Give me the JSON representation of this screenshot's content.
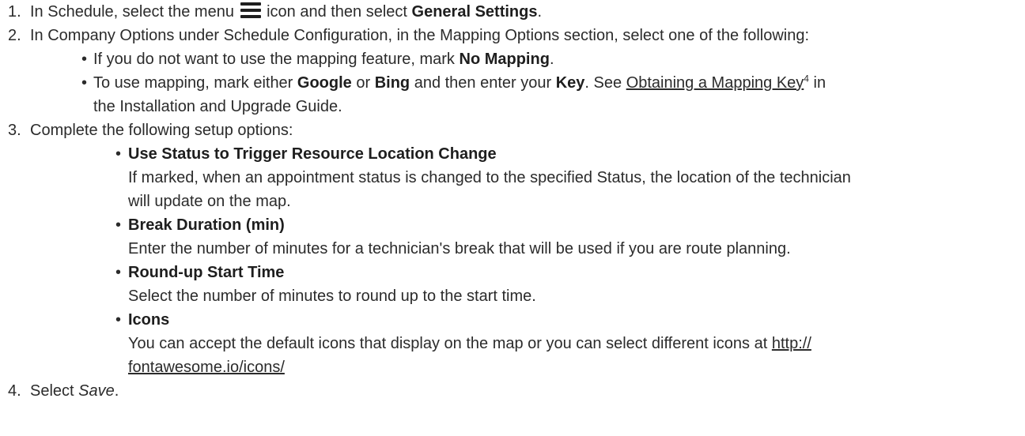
{
  "steps": [
    {
      "number": "1.",
      "t1": "In Schedule, select the menu",
      "icon": "menu-icon",
      "t2": " icon and then select ",
      "bold": "General Settings",
      "t3": "."
    },
    {
      "number": "2.",
      "text": "In Company Options under Schedule Configuration, in the Mapping Options section, select one of the following:",
      "bullets": [
        {
          "t1": "If you do not want to use the mapping feature, mark ",
          "b1": "No Mapping",
          "t2": "."
        },
        {
          "t1": "To use mapping, mark either ",
          "b1": "Google",
          "t2": " or ",
          "b2": "Bing",
          "t3": " and then enter your ",
          "b3": "Key",
          "t4": ". See ",
          "link": "Obtaining a Mapping Key",
          "sup": "4",
          "t5": " in",
          "cont": "the Installation and Upgrade Guide."
        }
      ]
    },
    {
      "number": "3.",
      "text": "Complete the following setup options:",
      "options": [
        {
          "title": "Use Status to Trigger Resource Location Change",
          "desc1": "If marked, when an appointment status is changed to the specified Status, the location of the technician",
          "desc2": "will update on the map."
        },
        {
          "title": "Break Duration (min)",
          "desc1": "Enter the number of minutes for a technician's break that will be used if you are route planning."
        },
        {
          "title": "Round-up Start Time",
          "desc1": "Select the number of minutes to round up to the start time."
        },
        {
          "title": "Icons",
          "desc1": "You can accept the default icons that display on the map or you can select different icons at ",
          "link1": "http://",
          "link2": "fontawesome.io/icons/"
        }
      ]
    },
    {
      "number": "4.",
      "t1": "Select ",
      "italic": "Save",
      "t2": "."
    }
  ],
  "bullet_char": "•"
}
